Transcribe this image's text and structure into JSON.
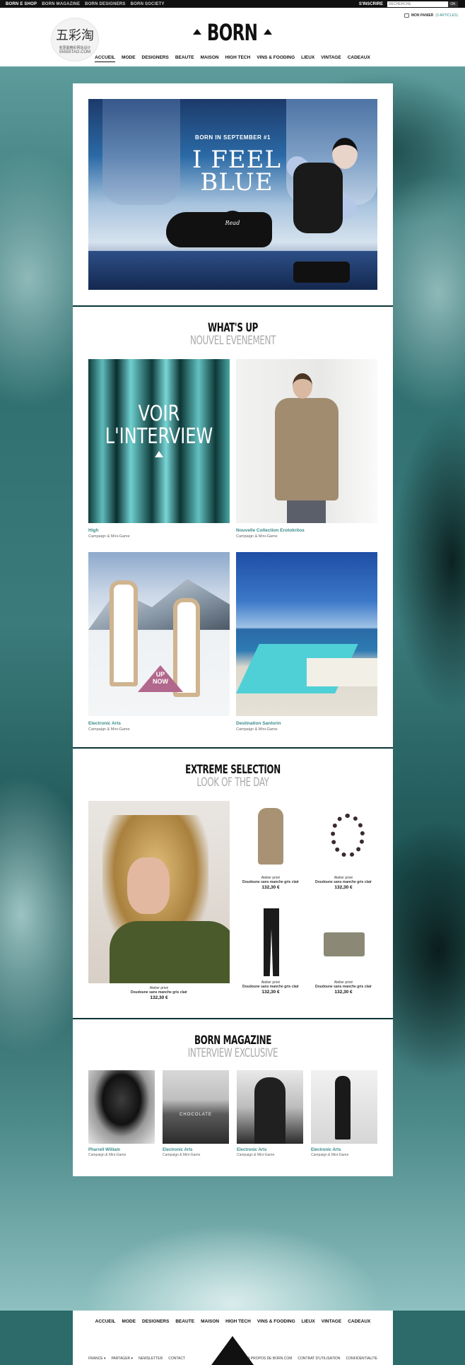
{
  "topbar": {
    "links": [
      "BORN E SHOP",
      "BORN MAGAZINE",
      "BORN DESIGNERS",
      "BORN SOCIETY"
    ],
    "signin": "S'INSCRIRE",
    "search_placeholder": "RECHERCHE",
    "search_ok": "OK"
  },
  "header": {
    "logo_cn": "五彩淘",
    "logo_small": "收录最精彩网站设计",
    "logo_url": "55555TAO.COM",
    "brand": "BORN",
    "wishlist_label": "MON PANIER",
    "wishlist_count": "(0 ARTICLES)"
  },
  "nav": [
    "ACCUEIL",
    "MODE",
    "DESIGNERS",
    "BEAUTE",
    "MAISON",
    "HIGH TECH",
    "VINS & FOODING",
    "LIEUX",
    "VINTAGE",
    "CADEAUX"
  ],
  "hero": {
    "kicker": "BORN IN SEPTEMBER  #1",
    "title_line1": "I FEEL",
    "title_line2": "BLUE",
    "read": "Read"
  },
  "whats_up": {
    "title": "WHAT'S UP",
    "subtitle": "NOUVEL EVENEMENT",
    "cards": [
      {
        "overlay1": "VOIR",
        "overlay2": "L'INTERVIEW",
        "title": "High",
        "sub": "Campaign & Mini-Game"
      },
      {
        "title": "Nouvelle Collection Erotokritos",
        "sub": "Campaign & Mini-Game"
      },
      {
        "badge1": "UP",
        "badge2": "NOW",
        "title": "Electronic Arts",
        "sub": "Campaign & Mini-Game"
      },
      {
        "title": "Destination Santorin",
        "sub": "Campaign & Mini-Game"
      }
    ]
  },
  "extreme": {
    "title": "EXTREME SELECTION",
    "subtitle": "LOOK OF THE DAY",
    "look": {
      "brand": "Atelier privé",
      "name": "Doudoune sans manche gris clair",
      "price": "132,30 €"
    },
    "products": [
      {
        "brand": "Atelier privé",
        "name": "Doudoune sans manche gris clair",
        "price": "132,30 €"
      },
      {
        "brand": "Atelier privé",
        "name": "Doudoune sans manche gris clair",
        "price": "132,30 €"
      },
      {
        "brand": "Atelier privé",
        "name": "Doudoune sans manche gris clair",
        "price": "132,30 €"
      },
      {
        "brand": "Atelier privé",
        "name": "Doudoune sans manche gris clair",
        "price": "132,30 €"
      }
    ]
  },
  "magazine": {
    "title": "BORN MAGAZINE",
    "subtitle": "INTERVIEW EXCLUSIVE",
    "items": [
      {
        "title": "Pharrell William",
        "sub": "Campaign & Mini-Game"
      },
      {
        "title": "Electronic Arts",
        "sub": "Campaign & Mini-Game",
        "overlay": "CHOCOLATE"
      },
      {
        "title": "Electronic Arts",
        "sub": "Campaign & Mini-Game"
      },
      {
        "title": "Electronic Arts",
        "sub": "Campaign & Mini-Game"
      }
    ]
  },
  "footer": {
    "nav": [
      "ACCUEIL",
      "MODE",
      "DESIGNERS",
      "BEAUTE",
      "MAISON",
      "HIGH TECH",
      "VINS & FOODING",
      "LIEUX",
      "VINTAGE",
      "CADEAUX"
    ],
    "left_links": [
      "FRANCE ▾",
      "PARTAGER ▾",
      "NEWSLETTER",
      "CONTACT"
    ],
    "right_links": [
      "A PROPOS DE BORN.COM",
      "CONTRAT D'UTILISATION",
      "CONFIDENTIALITE"
    ]
  },
  "colors": {
    "accent": "#3a8a8a",
    "background": "#2d6a6a",
    "topbar": "#111111"
  }
}
